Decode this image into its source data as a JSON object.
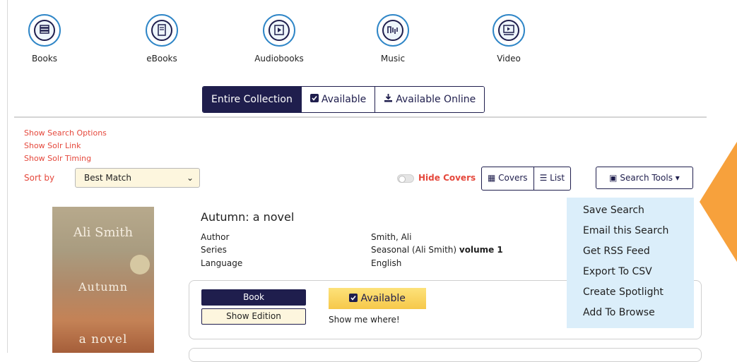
{
  "formats": [
    {
      "label": "Books",
      "icon": "books-icon"
    },
    {
      "label": "eBooks",
      "icon": "ebooks-icon"
    },
    {
      "label": "Audiobooks",
      "icon": "audiobooks-icon"
    },
    {
      "label": "Music",
      "icon": "music-icon"
    },
    {
      "label": "Video",
      "icon": "video-icon"
    }
  ],
  "collection_tabs": [
    "Entire Collection",
    "Available",
    "Available Online"
  ],
  "links": [
    "Show Search Options",
    "Show Solr Link",
    "Show Solr Timing"
  ],
  "sort": {
    "label": "Sort by",
    "value": "Best Match"
  },
  "hide_covers": "Hide Covers",
  "view": {
    "covers": "Covers",
    "list": "List"
  },
  "search_tools": "Search Tools",
  "dropdown_items": [
    "Save Search",
    "Email this Search",
    "Get RSS Feed",
    "Export To CSV",
    "Create Spotlight",
    "Add To Browse"
  ],
  "result": {
    "title": "Autumn: a novel",
    "fields": [
      {
        "key": "Author",
        "value": "Smith, Ali",
        "extra": ""
      },
      {
        "key": "Series",
        "value": "Seasonal (Ali Smith)",
        "extra": "volume 1"
      },
      {
        "key": "Language",
        "value": "English",
        "extra": ""
      }
    ],
    "format_button": "Book",
    "edition_button": "Show Edition",
    "availability": "Available",
    "where": "Show me where!",
    "cover": {
      "author": "Ali Smith",
      "title1": "Autumn",
      "title2": "a novel"
    }
  },
  "colors": {
    "navy": "#1f1e4d",
    "accent_red": "#e5483c",
    "orange": "#f7a13c",
    "dropdown_bg": "#dbeefa",
    "available_yellow": "#f6c84a"
  }
}
